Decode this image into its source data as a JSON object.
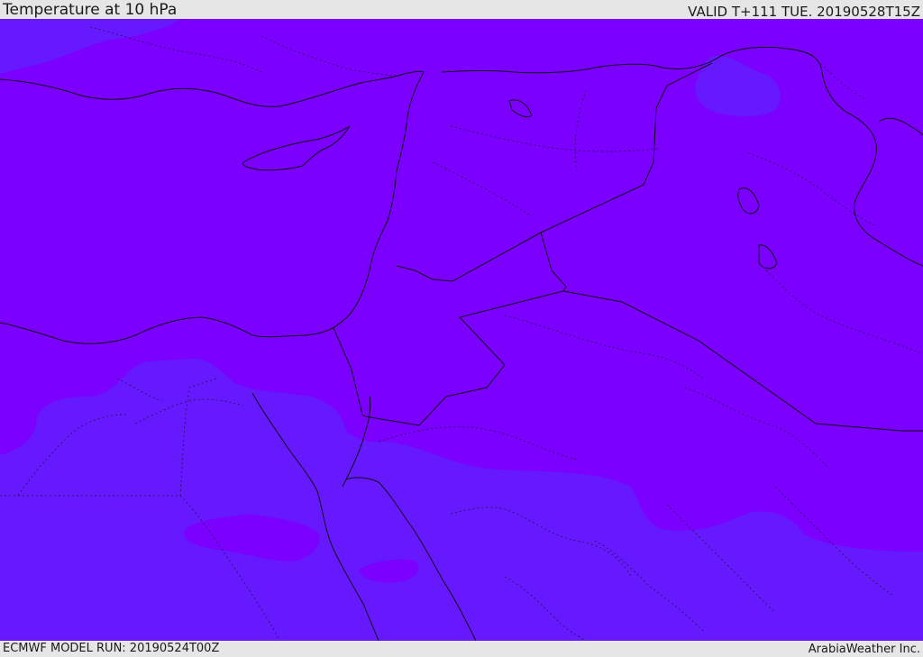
{
  "header": {
    "title": "Temperature at 10 hPa",
    "valid": "VALID T+111 TUE. 20190528T15Z"
  },
  "footer": {
    "model_run": "ECMWF MODEL RUN: 20190524T00Z",
    "credit": "ArabiaWeather Inc."
  },
  "colors": {
    "field_warm": "#7b00ff",
    "field_cool": "#6618ff",
    "borders": "#111111",
    "frame": "#e6e6e6"
  }
}
